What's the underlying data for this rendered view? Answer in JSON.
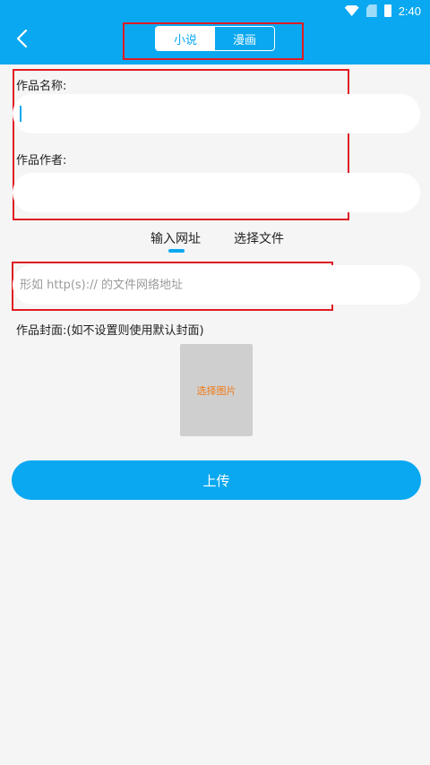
{
  "status_bar": {
    "time": "2:40"
  },
  "colors": {
    "primary": "#0aa8f0",
    "highlight": "#e01b24",
    "cover_text": "#f07a16"
  },
  "header": {
    "back_icon": "chevron-left-icon",
    "toggle": [
      {
        "label": "小说",
        "active": true
      },
      {
        "label": "漫画",
        "active": false
      }
    ]
  },
  "form": {
    "name_label": "作品名称:",
    "author_label": "作品作者:",
    "source_tabs": [
      {
        "label": "输入网址",
        "active": true
      },
      {
        "label": "选择文件",
        "active": false
      }
    ],
    "url_placeholder": "形如 http(s):// 的文件网络地址",
    "cover_label": "作品封面:(如不设置则使用默认封面)",
    "cover_button": "选择图片",
    "upload_button": "上传"
  }
}
